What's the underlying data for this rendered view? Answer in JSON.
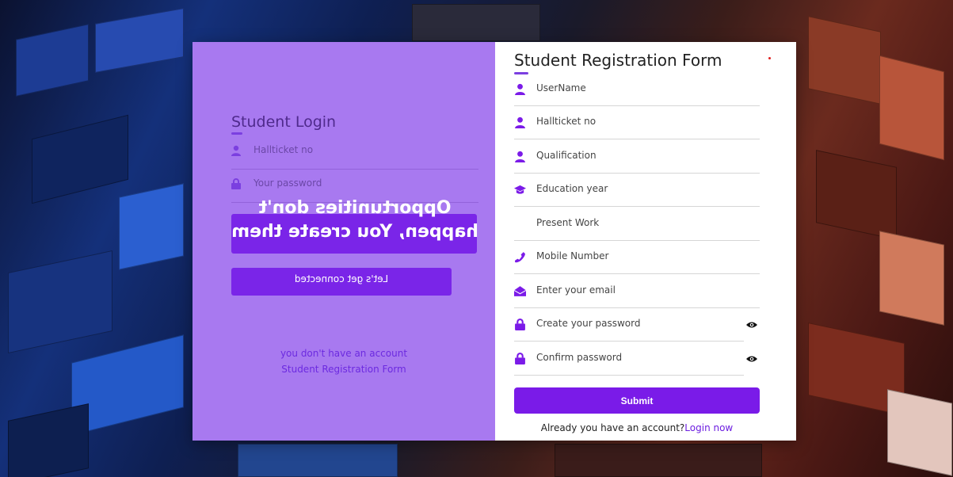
{
  "login": {
    "title": "Student Login",
    "hallticket_placeholder": "Hallticket no",
    "password_placeholder": "Your password",
    "quote": "Opportunities don't happen, You create them",
    "cta_button": "Let's get connected",
    "no_account": "you don't have an account",
    "register_link": "Student Registration Form"
  },
  "register": {
    "title": "Student Registration Form",
    "fields": [
      {
        "icon": "user-icon",
        "placeholder": "UserName"
      },
      {
        "icon": "user-icon",
        "placeholder": "Hallticket no"
      },
      {
        "icon": "user-icon",
        "placeholder": "Qualification"
      },
      {
        "icon": "graduation-cap-icon",
        "placeholder": "Education year"
      },
      {
        "icon": "",
        "placeholder": "Present Work"
      },
      {
        "icon": "phone-icon",
        "placeholder": "Mobile Number"
      },
      {
        "icon": "envelope-open-icon",
        "placeholder": "Enter your email"
      },
      {
        "icon": "lock-icon",
        "placeholder": "Create your password"
      },
      {
        "icon": "lock-icon",
        "placeholder": "Confirm password"
      }
    ],
    "submit_label": "Submit",
    "already_text": "Already you have an account?",
    "login_link": "Login now"
  },
  "colors": {
    "accent": "#7a1be8",
    "left_panel": "#a879f0",
    "right_panel": "#ffffff"
  }
}
